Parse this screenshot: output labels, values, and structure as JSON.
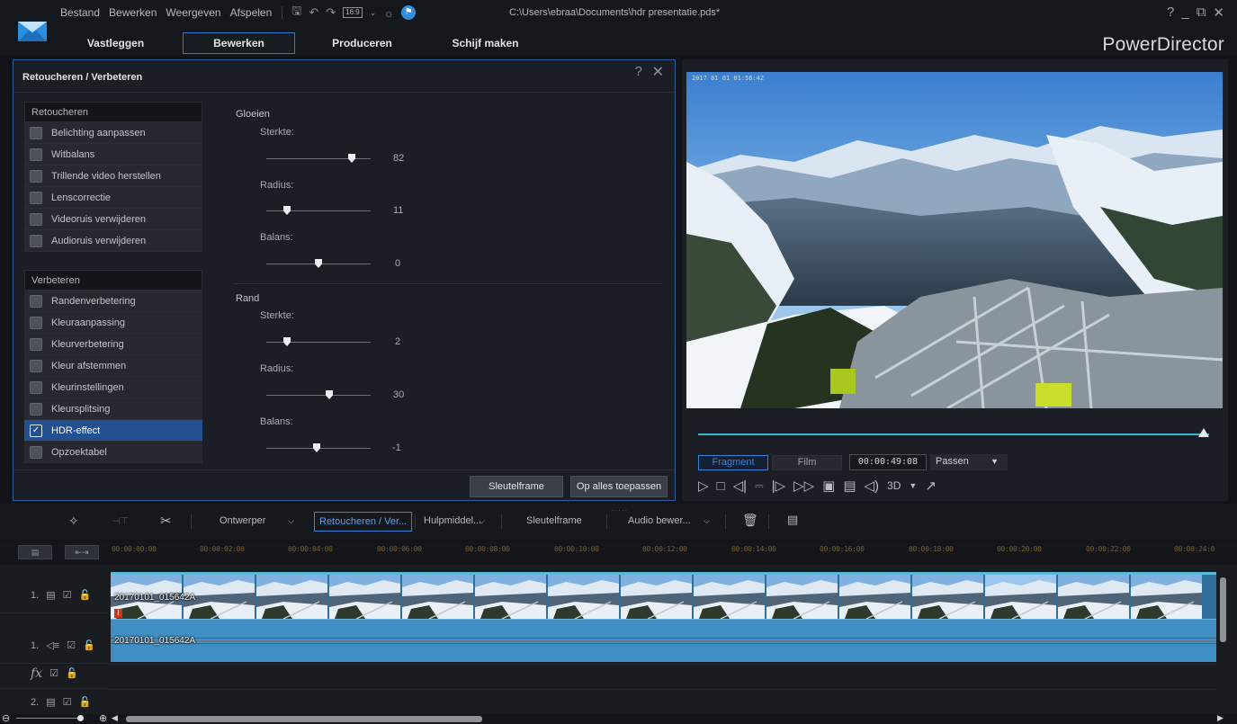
{
  "app": {
    "menu": [
      "Bestand",
      "Bewerken",
      "Weergeven",
      "Afspelen"
    ],
    "aspect_ratio": "16:9",
    "file_path": "C:\\Users\\ebraa\\Documents\\hdr presentatie.pds*",
    "window_controls": [
      "?",
      "_",
      "⧉",
      "✕"
    ],
    "mode_tabs": [
      "Vastleggen",
      "Bewerken",
      "Produceren",
      "Schijf maken"
    ],
    "active_mode": "Bewerken",
    "brand": "PowerDirector",
    "accent_color": "#3877c9"
  },
  "fix_panel": {
    "title": "Retoucheren / Verbeteren",
    "help": "?",
    "close": "✕",
    "retouch": {
      "header": "Retoucheren",
      "items": [
        {
          "label": "Belichting aanpassen",
          "checked": false
        },
        {
          "label": "Witbalans",
          "checked": false
        },
        {
          "label": "Trillende video herstellen",
          "checked": false
        },
        {
          "label": "Lenscorrectie",
          "checked": false
        },
        {
          "label": "Videoruis verwijderen",
          "checked": false
        },
        {
          "label": "Audioruis verwijderen",
          "checked": false
        }
      ]
    },
    "enhance": {
      "header": "Verbeteren",
      "items": [
        {
          "label": "Randenverbetering",
          "checked": false
        },
        {
          "label": "Kleuraanpassing",
          "checked": false
        },
        {
          "label": "Kleurverbetering",
          "checked": false
        },
        {
          "label": "Kleur afstemmen",
          "checked": false
        },
        {
          "label": "Kleurinstellingen",
          "checked": false
        },
        {
          "label": "Kleursplitsing",
          "checked": false
        },
        {
          "label": "HDR-effect",
          "checked": true
        },
        {
          "label": "Opzoektabel",
          "checked": false
        }
      ]
    },
    "glow": {
      "title": "Gloeien",
      "strength_label": "Sterkte:",
      "strength": "82",
      "radius_label": "Radius:",
      "radius": "11",
      "balance_label": "Balans:",
      "balance": "0",
      "strength_level": 0.82,
      "radius_level": 0.2,
      "balance_level": 0.5
    },
    "edge": {
      "title": "Rand",
      "strength_label": "Sterkte:",
      "strength": "2",
      "radius_label": "Radius:",
      "radius": "30",
      "balance_label": "Balans:",
      "balance": "-1",
      "strength_level": 0.2,
      "radius_level": 0.6,
      "balance_level": 0.48
    },
    "keyframe_button": "Sleutelframe",
    "apply_all_button": "Op alles toepassen"
  },
  "preview": {
    "overlay_timestamp": "2017 01 01 01:56:42",
    "tab_clip": "Fragment",
    "tab_movie": "Film",
    "timecode": "00:00:49:08",
    "fit": "Passen",
    "mode_3d": "3D",
    "progress": 0.99
  },
  "timeline_toolbar": {
    "designer": "Ontwerper",
    "fix_enhance": "Retoucheren / Ver...",
    "tools": "Hulpmiddel...",
    "keyframe": "Sleutelframe",
    "audio_editing": "Audio bewer..."
  },
  "timeline": {
    "ticks": [
      "00:00:00:00",
      "00:00:02:00",
      "00:00:04:00",
      "00:00:06:00",
      "00:00:08:00",
      "00:00:10:00",
      "00:00:12:00",
      "00:00:14:00",
      "00:00:16:00",
      "00:00:18:00",
      "00:00:20:00",
      "00:00:22:00",
      "00:00:24:0"
    ],
    "video_track": "1.",
    "audio_track": "1.",
    "fx_track": "fx",
    "video_track_2": "2.",
    "video_clip_name": "20170101_015642A",
    "audio_clip_name": "20170101_015642A"
  }
}
